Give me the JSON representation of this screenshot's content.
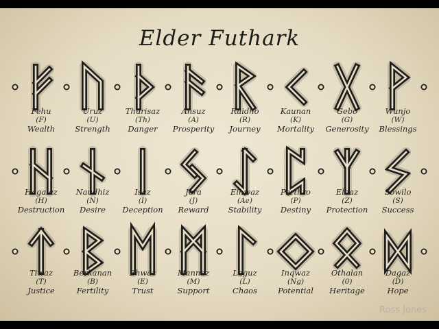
{
  "title": "Elder Futhark",
  "watermark": "Ross Jones",
  "runes": [
    {
      "name": "Fehu",
      "letter": "(F)",
      "meaning": "Wealth",
      "icon": "fehu-rune-icon"
    },
    {
      "name": "Uruz",
      "letter": "(U)",
      "meaning": "Strength",
      "icon": "uruz-rune-icon"
    },
    {
      "name": "Thurisaz",
      "letter": "(Th)",
      "meaning": "Danger",
      "icon": "thurisaz-rune-icon"
    },
    {
      "name": "Ansuz",
      "letter": "(A)",
      "meaning": "Prosperity",
      "icon": "ansuz-rune-icon"
    },
    {
      "name": "Raidho",
      "letter": "(R)",
      "meaning": "Journey",
      "icon": "raidho-rune-icon"
    },
    {
      "name": "Kaunan",
      "letter": "(K)",
      "meaning": "Mortality",
      "icon": "kaunan-rune-icon"
    },
    {
      "name": "Gebo",
      "letter": "(G)",
      "meaning": "Generosity",
      "icon": "gebo-rune-icon"
    },
    {
      "name": "Wunjo",
      "letter": "(W)",
      "meaning": "Blessings",
      "icon": "wunjo-rune-icon"
    },
    {
      "name": "Hagalaz",
      "letter": "(H)",
      "meaning": "Destruction",
      "icon": "hagalaz-rune-icon"
    },
    {
      "name": "Naudhiz",
      "letter": "(N)",
      "meaning": "Desire",
      "icon": "naudhiz-rune-icon"
    },
    {
      "name": "Isaz",
      "letter": "(I)",
      "meaning": "Deception",
      "icon": "isaz-rune-icon"
    },
    {
      "name": "Jera",
      "letter": "(J)",
      "meaning": "Reward",
      "icon": "jera-rune-icon"
    },
    {
      "name": "Eihwaz",
      "letter": "(Ae)",
      "meaning": "Stability",
      "icon": "eihwaz-rune-icon"
    },
    {
      "name": "Perthro",
      "letter": "(P)",
      "meaning": "Destiny",
      "icon": "perthro-rune-icon"
    },
    {
      "name": "Elhaz",
      "letter": "(Z)",
      "meaning": "Protection",
      "icon": "elhaz-rune-icon"
    },
    {
      "name": "Sowilo",
      "letter": "(S)",
      "meaning": "Success",
      "icon": "sowilo-rune-icon"
    },
    {
      "name": "Tiwaz",
      "letter": "(T)",
      "meaning": "Justice",
      "icon": "tiwaz-rune-icon"
    },
    {
      "name": "Berkanan",
      "letter": "(B)",
      "meaning": "Fertility",
      "icon": "berkanan-rune-icon"
    },
    {
      "name": "Ehwaz",
      "letter": "(E)",
      "meaning": "Trust",
      "icon": "ehwaz-rune-icon"
    },
    {
      "name": "Mannaz",
      "letter": "(M)",
      "meaning": "Support",
      "icon": "mannaz-rune-icon"
    },
    {
      "name": "Laguz",
      "letter": "(L)",
      "meaning": "Chaos",
      "icon": "laguz-rune-icon"
    },
    {
      "name": "Inqwaz",
      "letter": "(Ng)",
      "meaning": "Potential",
      "icon": "inqwaz-rune-icon"
    },
    {
      "name": "Othalan",
      "letter": "(0)",
      "meaning": "Heritage",
      "icon": "othalan-rune-icon"
    },
    {
      "name": "Dagaz",
      "letter": "(D)",
      "meaning": "Hope",
      "icon": "dagaz-rune-icon"
    }
  ],
  "colors": {
    "ink": "#1f1d1a",
    "parchment": "#e9e0c9"
  }
}
